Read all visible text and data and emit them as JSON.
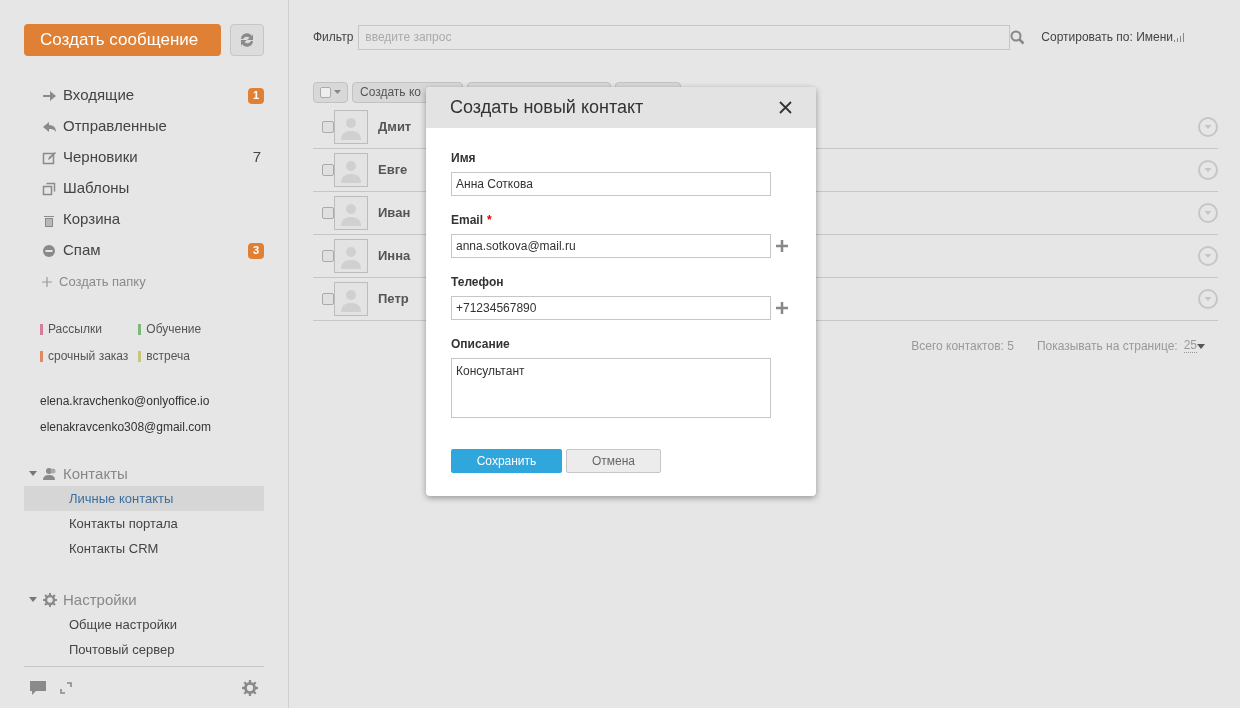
{
  "sidebar": {
    "compose_button": "Создать сообщение",
    "folders": [
      {
        "kind": "inbox",
        "label": "Входящие",
        "badge": "1"
      },
      {
        "kind": "sent",
        "label": "Отправленные"
      },
      {
        "kind": "drafts",
        "label": "Черновики",
        "count": "7"
      },
      {
        "kind": "templates",
        "label": "Шаблоны"
      },
      {
        "kind": "trash",
        "label": "Корзина"
      },
      {
        "kind": "spam",
        "label": "Спам",
        "badge": "3"
      }
    ],
    "create_folder": "Создать папку",
    "tags": [
      {
        "label": "Рассылки",
        "color": "#d47f97"
      },
      {
        "label": "Обучение",
        "color": "#7fb87f"
      },
      {
        "label": "срочный заказ",
        "color": "#e08a64"
      },
      {
        "label": "встреча",
        "color": "#c9c57a"
      }
    ],
    "accounts": [
      "elena.kravchenko@onlyoffice.io",
      "elenakravcenko308@gmail.com"
    ],
    "sections": [
      {
        "kind": "contacts",
        "title": "Контакты",
        "expanded": true,
        "items": [
          {
            "label": "Личные контакты",
            "selected": true
          },
          {
            "label": "Контакты портала",
            "selected": false
          },
          {
            "label": "Контакты CRM",
            "selected": false
          }
        ]
      },
      {
        "kind": "settings",
        "title": "Настройки",
        "expanded": true,
        "items": [
          {
            "label": "Общие настройки",
            "selected": false
          },
          {
            "label": "Почтовый сервер",
            "selected": false
          }
        ]
      }
    ]
  },
  "filter": {
    "label": "Фильтр",
    "placeholder": "введите запрос",
    "sort": "Сортировать по: Имени"
  },
  "toolbar": {
    "first_button": "Создать ко"
  },
  "contacts": [
    {
      "name": "Дмит",
      "checked": false
    },
    {
      "name": "Евге",
      "checked": false
    },
    {
      "name": "Иван",
      "checked": false
    },
    {
      "name": "Инна",
      "checked": false
    },
    {
      "name": "Петр",
      "checked": false
    }
  ],
  "footer": {
    "total": "Всего контактов: 5",
    "per_page_label": "Показывать на странице:",
    "per_page": "25"
  },
  "dialog": {
    "title": "Создать новый контакт",
    "fields": [
      {
        "kind": "text",
        "label": "Имя",
        "value": "Анна Соткова",
        "addable": false
      },
      {
        "kind": "text",
        "label": "Email",
        "value": "anna.sotkova@mail.ru",
        "required_mark": "*",
        "addable": true
      },
      {
        "kind": "text",
        "label": "Телефон",
        "value": "+71234567890",
        "addable": true
      },
      {
        "kind": "textarea",
        "label": "Описание",
        "value": "Консультант",
        "addable": false
      }
    ],
    "save": "Сохранить",
    "cancel": "Отмена"
  }
}
